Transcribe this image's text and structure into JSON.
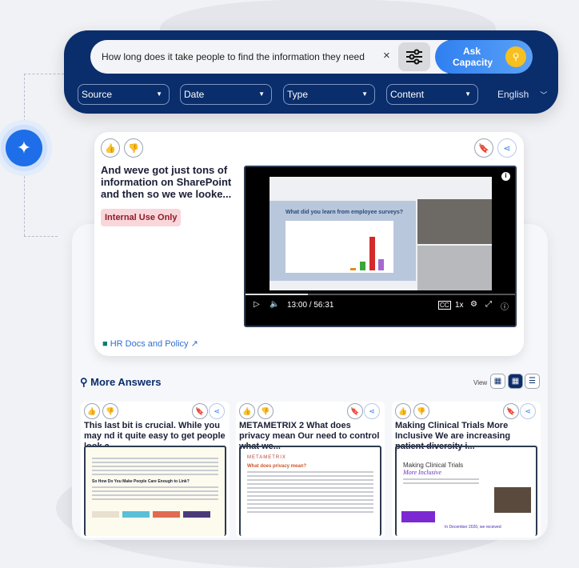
{
  "search": {
    "query": "How long does it take people to find the information they need",
    "clear": "×",
    "ask_label": "Ask Capacity"
  },
  "filters": [
    {
      "label": "Source"
    },
    {
      "label": "Date"
    },
    {
      "label": "Type"
    },
    {
      "label": "Content"
    }
  ],
  "language": "English",
  "main_answer": {
    "title": "And weve got just tons of information on SharePoint and then so we we looke...",
    "tag": "Internal Use Only",
    "source": "HR Docs and Policy",
    "video": {
      "slide_title": "What did you learn from employee surveys?",
      "time": "13:00 / 56:31",
      "speed": "1x",
      "cc": "CC",
      "progress": 0.23
    }
  },
  "more_answers": {
    "heading": "More Answers",
    "view_label": "View",
    "cards": [
      {
        "title": "This last bit is crucial. While you may nd it quite easy to get people look a...",
        "preview_heading": "So How Do You Make People Care Enough to Link?"
      },
      {
        "title": "METAMETRIX 2 What does privacy mean Our need to control what we...",
        "preview_brand": "METAMETRIX",
        "preview_heading": "What does privacy mean?"
      },
      {
        "title": "Making Clinical Trials More Inclusive We are increasing patient diversity i...",
        "preview_heading": "Making Clinical Trials",
        "preview_sub": "More Inclusive",
        "preview_foot": "In December 2020, we received"
      }
    ]
  },
  "colors": {
    "navy": "#0a2d6b",
    "accent": "#2f7ff0",
    "tag_bg": "#f9d6da"
  }
}
